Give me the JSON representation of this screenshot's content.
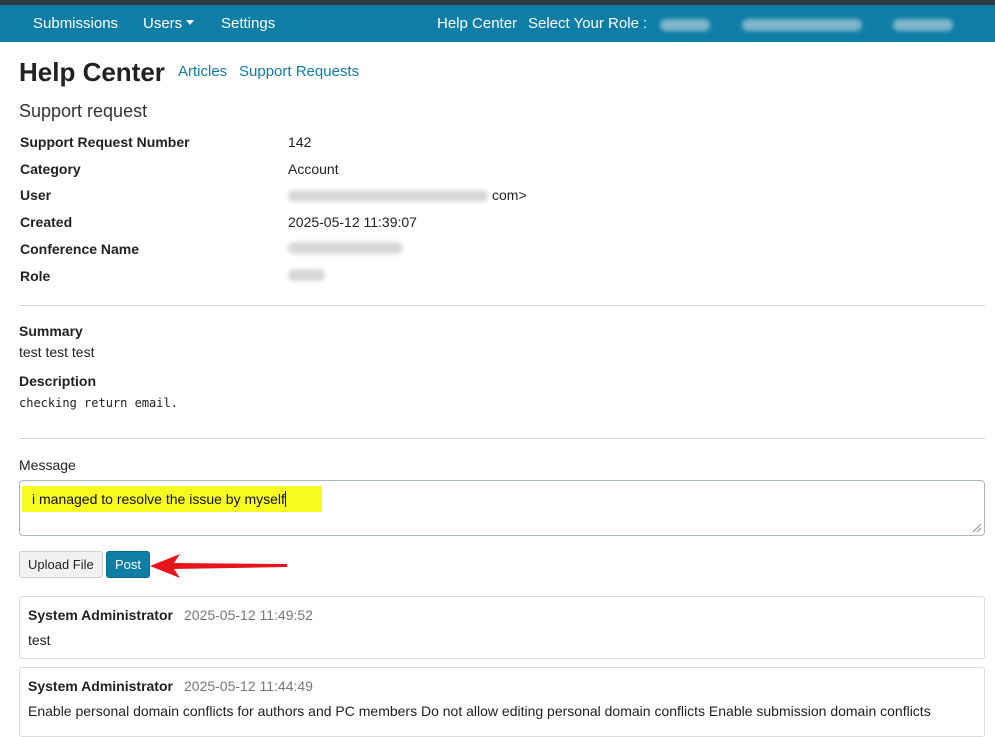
{
  "navbar": {
    "items": [
      {
        "label": "Submissions"
      },
      {
        "label": "Users"
      },
      {
        "label": "Settings"
      }
    ],
    "help_center": "Help Center",
    "select_role_label": "Select Your Role :"
  },
  "header": {
    "title": "Help Center",
    "links": [
      {
        "label": "Articles"
      },
      {
        "label": "Support Requests"
      }
    ]
  },
  "request": {
    "section_title": "Support request",
    "fields": [
      {
        "label": "Support Request Number",
        "value": "142"
      },
      {
        "label": "Category",
        "value": "Account"
      },
      {
        "label": "User",
        "value": "com>"
      },
      {
        "label": "Created",
        "value": "2025-05-12 11:39:07"
      },
      {
        "label": "Conference Name",
        "value": ""
      },
      {
        "label": "Role",
        "value": ""
      }
    ],
    "summary_label": "Summary",
    "summary": "test test test",
    "description_label": "Description",
    "description": "checking return email."
  },
  "message": {
    "label": "Message",
    "value": "i managed to resolve the issue by myself",
    "upload_label": "Upload File",
    "post_label": "Post"
  },
  "messages": [
    {
      "author": "System Administrator",
      "time": "2025-05-12 11:49:52",
      "body": "test"
    },
    {
      "author": "System Administrator",
      "time": "2025-05-12 11:44:49",
      "body": "Enable personal domain conflicts for authors and PC members Do not allow editing personal domain conflicts  Enable submission domain conflicts"
    }
  ],
  "colors": {
    "navbar": "#0e7ea6",
    "link": "#0e7ea6",
    "highlight": "#f8fb1f",
    "arrow": "#e8141b"
  }
}
